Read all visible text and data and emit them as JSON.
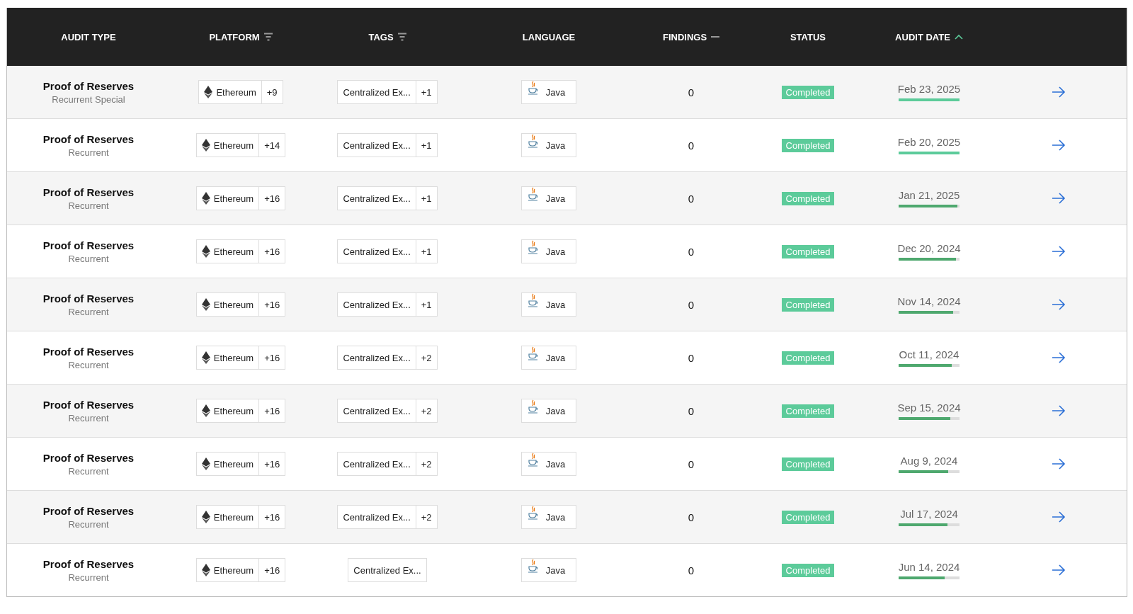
{
  "table": {
    "columns": [
      {
        "label": "AUDIT TYPE",
        "kind": "plain"
      },
      {
        "label": "PLATFORM",
        "kind": "filter"
      },
      {
        "label": "TAGS",
        "kind": "filter"
      },
      {
        "label": "LANGUAGE",
        "kind": "plain"
      },
      {
        "label": "FINDINGS",
        "kind": "unsorted"
      },
      {
        "label": "STATUS",
        "kind": "plain"
      },
      {
        "label": "AUDIT DATE",
        "kind": "ascending"
      }
    ],
    "rows": [
      {
        "audit_type": "Proof of Reserves",
        "subtype": "Recurrent Special",
        "platform": "Ethereum",
        "platform_more": "+9",
        "tag": "Centralized Ex...",
        "tag_more": "+1",
        "language": "Java",
        "findings": "0",
        "status": "Completed",
        "date": "Feb 23, 2025",
        "level": 1.0
      },
      {
        "audit_type": "Proof of Reserves",
        "subtype": "Recurrent",
        "platform": "Ethereum",
        "platform_more": "+14",
        "tag": "Centralized Ex...",
        "tag_more": "+1",
        "language": "Java",
        "findings": "0",
        "status": "Completed",
        "date": "Feb 20, 2025",
        "level": 1.0
      },
      {
        "audit_type": "Proof of Reserves",
        "subtype": "Recurrent",
        "platform": "Ethereum",
        "platform_more": "+16",
        "tag": "Centralized Ex...",
        "tag_more": "+1",
        "language": "Java",
        "findings": "0",
        "status": "Completed",
        "date": "Jan 21, 2025",
        "level": 0.97
      },
      {
        "audit_type": "Proof of Reserves",
        "subtype": "Recurrent",
        "platform": "Ethereum",
        "platform_more": "+16",
        "tag": "Centralized Ex...",
        "tag_more": "+1",
        "language": "Java",
        "findings": "0",
        "status": "Completed",
        "date": "Dec 20, 2024",
        "level": 0.94
      },
      {
        "audit_type": "Proof of Reserves",
        "subtype": "Recurrent",
        "platform": "Ethereum",
        "platform_more": "+16",
        "tag": "Centralized Ex...",
        "tag_more": "+1",
        "language": "Java",
        "findings": "0",
        "status": "Completed",
        "date": "Nov 14, 2024",
        "level": 0.9
      },
      {
        "audit_type": "Proof of Reserves",
        "subtype": "Recurrent",
        "platform": "Ethereum",
        "platform_more": "+16",
        "tag": "Centralized Ex...",
        "tag_more": "+2",
        "language": "Java",
        "findings": "0",
        "status": "Completed",
        "date": "Oct 11, 2024",
        "level": 0.87
      },
      {
        "audit_type": "Proof of Reserves",
        "subtype": "Recurrent",
        "platform": "Ethereum",
        "platform_more": "+16",
        "tag": "Centralized Ex...",
        "tag_more": "+2",
        "language": "Java",
        "findings": "0",
        "status": "Completed",
        "date": "Sep 15, 2024",
        "level": 0.85
      },
      {
        "audit_type": "Proof of Reserves",
        "subtype": "Recurrent",
        "platform": "Ethereum",
        "platform_more": "+16",
        "tag": "Centralized Ex...",
        "tag_more": "+2",
        "language": "Java",
        "findings": "0",
        "status": "Completed",
        "date": "Aug 9, 2024",
        "level": 0.81
      },
      {
        "audit_type": "Proof of Reserves",
        "subtype": "Recurrent",
        "platform": "Ethereum",
        "platform_more": "+16",
        "tag": "Centralized Ex...",
        "tag_more": "+2",
        "language": "Java",
        "findings": "0",
        "status": "Completed",
        "date": "Jul 17, 2024",
        "level": 0.8
      },
      {
        "audit_type": "Proof of Reserves",
        "subtype": "Recurrent",
        "platform": "Ethereum",
        "platform_more": "+16",
        "tag": "Centralized Ex...",
        "language": "Java",
        "findings": "0",
        "status": "Completed",
        "date": "Jun 14, 2024",
        "level": 0.76
      }
    ]
  }
}
